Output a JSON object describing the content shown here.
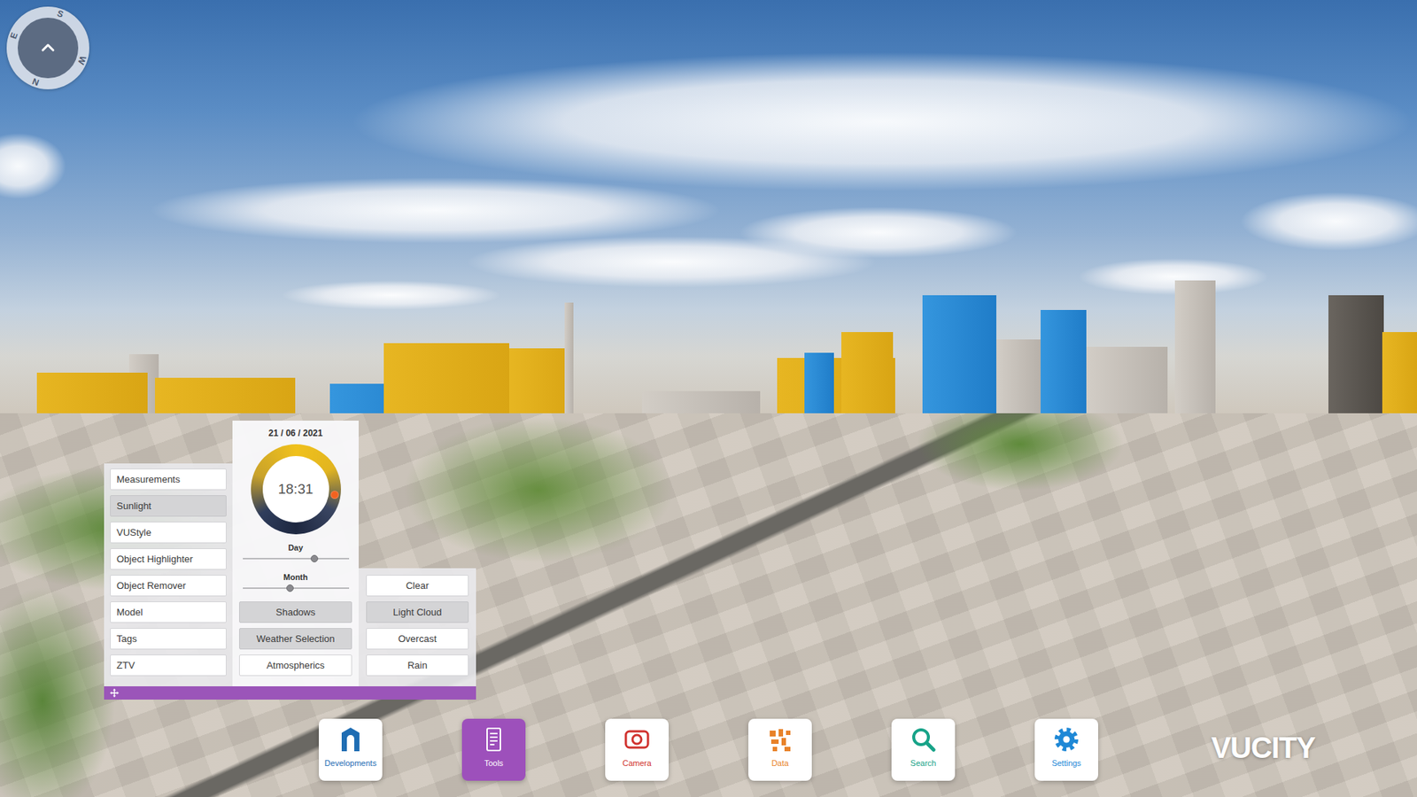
{
  "compass": {
    "labels": [
      "S",
      "W",
      "N",
      "E"
    ]
  },
  "tools_menu": {
    "items": [
      {
        "label": "Measurements",
        "selected": false
      },
      {
        "label": "Sunlight",
        "selected": true
      },
      {
        "label": "VUStyle",
        "selected": false
      },
      {
        "label": "Object Highlighter",
        "selected": false
      },
      {
        "label": "Object Remover",
        "selected": false
      },
      {
        "label": "Model",
        "selected": false
      },
      {
        "label": "Tags",
        "selected": false
      },
      {
        "label": "ZTV",
        "selected": false
      }
    ]
  },
  "sunlight": {
    "date": "21 / 06 / 2021",
    "time": "18:31",
    "sun_level": 0.771,
    "sliders": [
      {
        "label": "Day",
        "level": 0.68
      },
      {
        "label": "Month",
        "level": 0.45
      }
    ],
    "options": [
      {
        "label": "Shadows",
        "selected": true
      },
      {
        "label": "Weather Selection",
        "selected": true
      },
      {
        "label": "Atmospherics",
        "selected": false
      }
    ]
  },
  "weather": {
    "options": [
      {
        "label": "Clear",
        "selected": false
      },
      {
        "label": "Light Cloud",
        "selected": true
      },
      {
        "label": "Overcast",
        "selected": false
      },
      {
        "label": "Rain",
        "selected": false
      }
    ]
  },
  "dock": {
    "items": [
      {
        "label": "Developments",
        "selected": false,
        "color": "#1f6db3"
      },
      {
        "label": "Tools",
        "selected": true,
        "color": "#ffffff"
      },
      {
        "label": "Camera",
        "selected": false,
        "color": "#d0312d"
      },
      {
        "label": "Data",
        "selected": false,
        "color": "#e8822a"
      },
      {
        "label": "Search",
        "selected": false,
        "color": "#17a388"
      },
      {
        "label": "Settings",
        "selected": false,
        "color": "#1e88d6"
      }
    ]
  },
  "logo": "VUCITY"
}
